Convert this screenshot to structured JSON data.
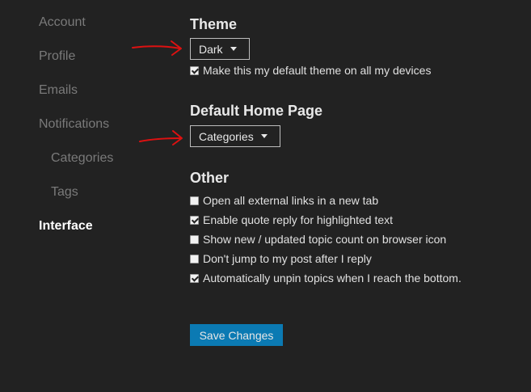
{
  "sidebar": {
    "items": [
      {
        "label": "Account"
      },
      {
        "label": "Profile"
      },
      {
        "label": "Emails"
      },
      {
        "label": "Notifications"
      },
      {
        "label": "Categories"
      },
      {
        "label": "Tags"
      },
      {
        "label": "Interface",
        "active": true
      }
    ]
  },
  "theme": {
    "title": "Theme",
    "selected": "Dark",
    "default_checkbox": {
      "label": "Make this my default theme on all my devices",
      "checked": true
    }
  },
  "home_page": {
    "title": "Default Home Page",
    "selected": "Categories"
  },
  "other": {
    "title": "Other",
    "options": [
      {
        "label": "Open all external links in a new tab",
        "checked": false
      },
      {
        "label": "Enable quote reply for highlighted text",
        "checked": true
      },
      {
        "label": "Show new / updated topic count on browser icon",
        "checked": false
      },
      {
        "label": "Don't jump to my post after I reply",
        "checked": false
      },
      {
        "label": "Automatically unpin topics when I reach the bottom.",
        "checked": true
      }
    ]
  },
  "actions": {
    "save_label": "Save Changes"
  },
  "colors": {
    "background": "#222222",
    "accent": "#0b7ab3",
    "annotation": "#dd1111"
  }
}
